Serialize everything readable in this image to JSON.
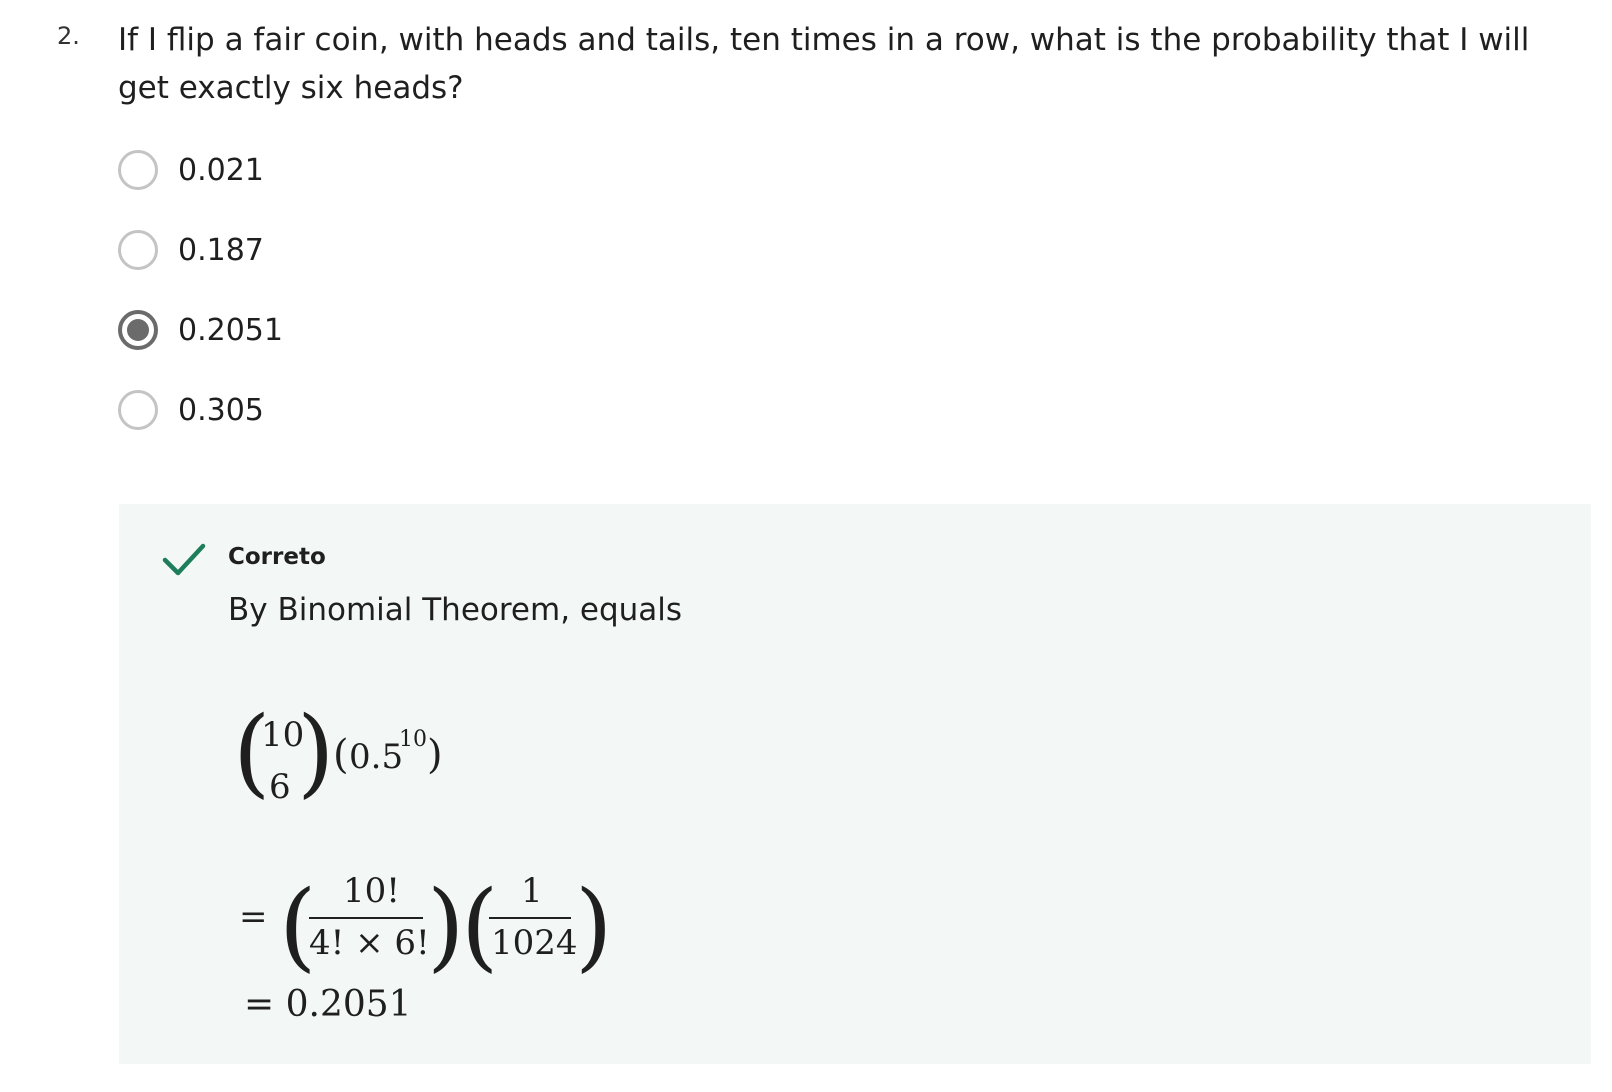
{
  "question": {
    "number": "2.",
    "text": "If I flip a fair coin, with heads and tails, ten times in a row, what is the probability that I will get exactly six heads?"
  },
  "options": [
    {
      "label": "0.021",
      "selected": false
    },
    {
      "label": "0.187",
      "selected": false
    },
    {
      "label": "0.2051",
      "selected": true
    },
    {
      "label": "0.305",
      "selected": false
    }
  ],
  "feedback": {
    "status": "Correto",
    "explanation": "By Binomial Theorem, equals",
    "accent_color": "#1e7d5a",
    "math": {
      "binom_top": "10",
      "binom_bottom": "6",
      "base": "0.5",
      "exponent": "10",
      "equals": "=",
      "frac1_num": "10!",
      "frac1_den": "4! × 6!",
      "frac2_num": "1",
      "frac2_den": "1024",
      "result": "= 0.2051"
    }
  }
}
